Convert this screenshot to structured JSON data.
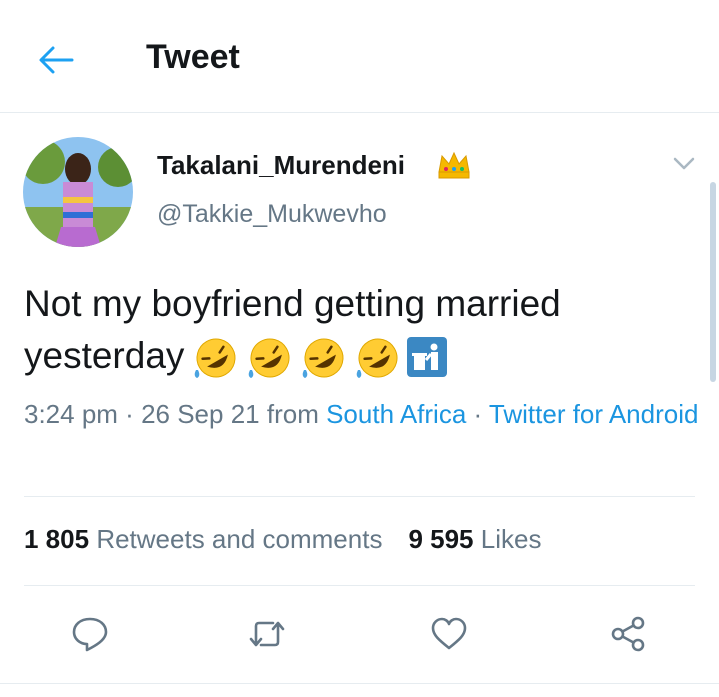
{
  "header": {
    "title": "Tweet"
  },
  "author": {
    "name": "Takalani_Murendeni",
    "handle": "@Takkie_Mukwevho"
  },
  "tweet": {
    "line1": "Not my boyfriend getting married",
    "line2": "yesterday",
    "emojis": [
      "rofl-emoji",
      "rofl-emoji",
      "rofl-emoji",
      "rofl-emoji",
      "trash-emoji"
    ]
  },
  "meta": {
    "time": "3:24 pm",
    "sep1": " · ",
    "date": "26 Sep 21",
    "from": " from ",
    "location": "South Africa",
    "sep2": " · ",
    "source": "Twitter for Android"
  },
  "stats": {
    "retweets_count": "1 805",
    "retweets_label": "Retweets and comments",
    "likes_count": "9 595",
    "likes_label": "Likes"
  },
  "icons": [
    "back-arrow-icon",
    "crown-icon",
    "chevron-down-icon",
    "reply-icon",
    "retweet-icon",
    "like-icon",
    "share-icon"
  ],
  "colors": {
    "accent": "#1b95e0",
    "secondary_text": "#657786",
    "divider": "#e6ecf0"
  }
}
